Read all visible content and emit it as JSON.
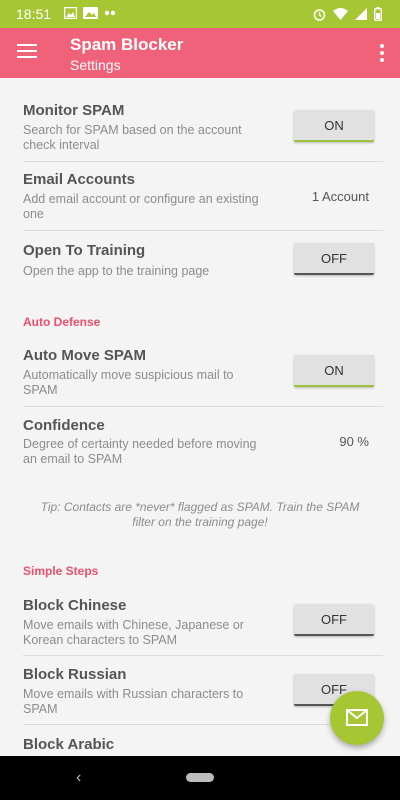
{
  "status_bar": {
    "time": "18:51",
    "left_icons": [
      "image-icon",
      "photo-icon",
      "more-dots-icon"
    ],
    "right_icons": [
      "alarm-icon",
      "wifi-icon",
      "signal-icon",
      "battery-icon"
    ]
  },
  "app_bar": {
    "title": "Spam Blocker",
    "subtitle": "Settings",
    "color": "#f0617a"
  },
  "settings": {
    "monitor_spam": {
      "title": "Monitor SPAM",
      "desc": "Search for SPAM based on the account check interval",
      "toggle": "ON"
    },
    "email_accounts": {
      "title": "Email Accounts",
      "desc": "Add email account or configure an existing one",
      "value": "1 Account"
    },
    "open_training": {
      "title": "Open To Training",
      "desc": "Open the app to the training page",
      "toggle": "OFF"
    }
  },
  "auto_defense": {
    "header": "Auto Defense",
    "auto_move": {
      "title": "Auto Move SPAM",
      "desc": "Automatically move suspicious mail to SPAM",
      "toggle": "ON"
    },
    "confidence": {
      "title": "Confidence",
      "desc": "Degree of certainty needed before moving an email to SPAM",
      "value": "90 %"
    },
    "tip": "Tip: Contacts are *never* flagged as SPAM. Train the SPAM filter on the training page!"
  },
  "simple_steps": {
    "header": "Simple Steps",
    "block_chinese": {
      "title": "Block Chinese",
      "desc": "Move emails with Chinese, Japanese or Korean characters to SPAM",
      "toggle": "OFF"
    },
    "block_russian": {
      "title": "Block Russian",
      "desc": "Move emails with Russian characters to SPAM",
      "toggle": "OFF"
    },
    "block_arabic": {
      "title": "Block Arabic"
    }
  },
  "fab": {
    "icon": "mail-icon",
    "color": "#a6c634"
  },
  "colors": {
    "accent_green": "#a6c634",
    "accent_pink": "#e8506c"
  }
}
